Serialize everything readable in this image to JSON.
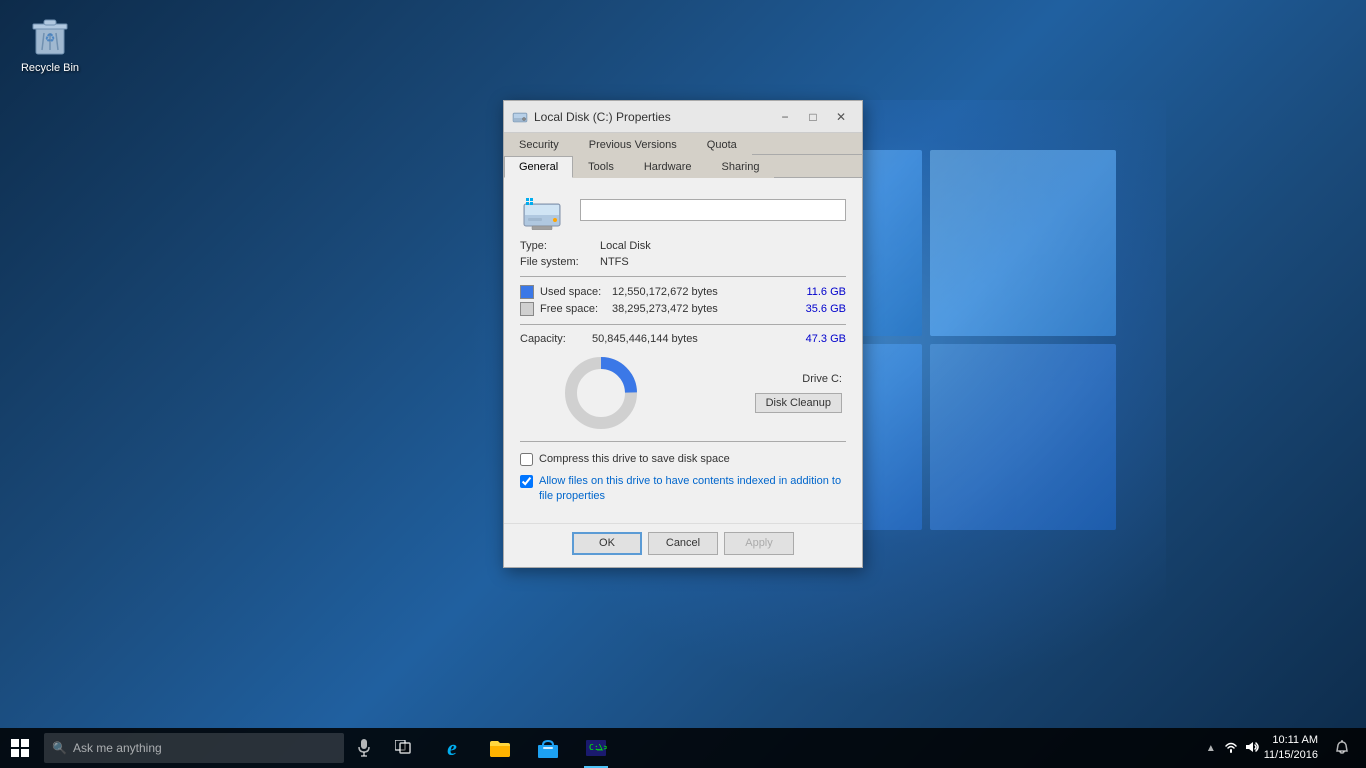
{
  "desktop": {
    "background_color": "#1a3a5c"
  },
  "recycle_bin": {
    "label": "Recycle Bin"
  },
  "dialog": {
    "title": "Local Disk (C:) Properties",
    "tabs_row1": [
      {
        "id": "security",
        "label": "Security",
        "active": false
      },
      {
        "id": "previous-versions",
        "label": "Previous Versions",
        "active": false
      },
      {
        "id": "quota",
        "label": "Quota",
        "active": false
      }
    ],
    "tabs_row2": [
      {
        "id": "general",
        "label": "General",
        "active": true
      },
      {
        "id": "tools",
        "label": "Tools",
        "active": false
      },
      {
        "id": "hardware",
        "label": "Hardware",
        "active": false
      },
      {
        "id": "sharing",
        "label": "Sharing",
        "active": false
      }
    ],
    "drive_name": "",
    "type_label": "Type:",
    "type_value": "Local Disk",
    "filesystem_label": "File system:",
    "filesystem_value": "NTFS",
    "used_space": {
      "label": "Used space:",
      "bytes": "12,550,172,672 bytes",
      "size": "11.6 GB",
      "color": "#3b78e7"
    },
    "free_space": {
      "label": "Free space:",
      "bytes": "38,295,273,472 bytes",
      "size": "35.6 GB",
      "color": "#d0d0d0"
    },
    "capacity": {
      "label": "Capacity:",
      "bytes": "50,845,446,144 bytes",
      "size": "47.3 GB"
    },
    "drive_label": "Drive C:",
    "disk_cleanup_button": "Disk Cleanup",
    "compress_label": "Compress this drive to save disk space",
    "index_label": "Allow files on this drive to have contents indexed in addition to file properties",
    "compress_checked": false,
    "index_checked": true,
    "chart": {
      "used_percent": 24.7,
      "free_percent": 75.3,
      "used_color": "#3b78e7",
      "free_color": "#d0d0d0"
    },
    "buttons": {
      "ok": "OK",
      "cancel": "Cancel",
      "apply": "Apply"
    }
  },
  "taskbar": {
    "search_placeholder": "Ask me anything",
    "time": "10:11 AM",
    "date": "11/15/2016",
    "apps": [
      {
        "id": "edge",
        "label": "Microsoft Edge"
      },
      {
        "id": "explorer",
        "label": "File Explorer"
      },
      {
        "id": "store",
        "label": "Windows Store"
      },
      {
        "id": "cmd",
        "label": "Command Prompt"
      }
    ]
  }
}
